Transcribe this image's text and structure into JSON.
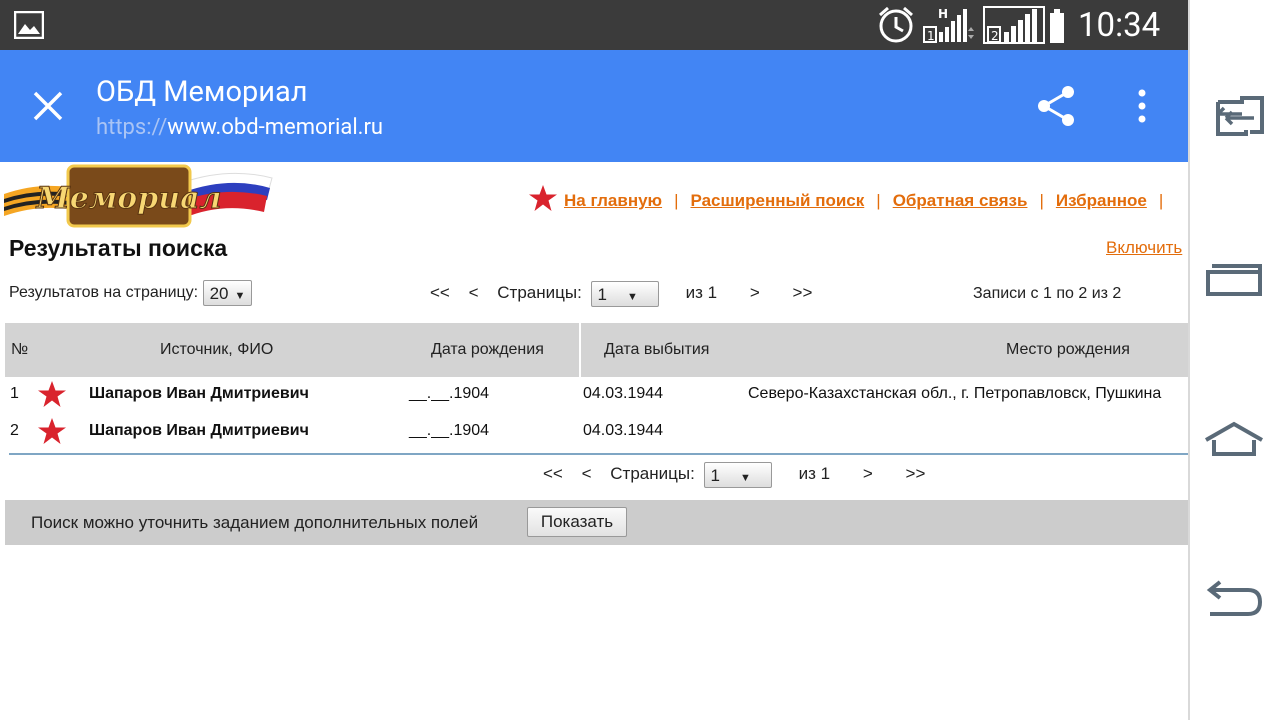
{
  "status": {
    "time": "10:34",
    "sim1": "1",
    "sim2": "2",
    "net": "H"
  },
  "appbar": {
    "title": "ОБД Мемориал",
    "url_scheme": "https://",
    "url_host": "www.obd-memorial.ru"
  },
  "web": {
    "logo_text": "Мемориал",
    "topnav": {
      "home": "На главную",
      "advanced": "Расширенный поиск",
      "feedback": "Обратная связь",
      "favorites": "Избранное",
      "sep": "|"
    },
    "heading": "Результаты поиска",
    "enable_link": "Включить",
    "perpage": {
      "label": "Результатов на страницу:",
      "value": "20"
    },
    "pager": {
      "first": "<<",
      "prev": "<",
      "pages_label": "Страницы:",
      "page": "1",
      "of": "из 1",
      "next": ">",
      "last": ">>"
    },
    "records": "Записи с 1 по 2 из 2",
    "table": {
      "columns": [
        "№",
        "Источник, ФИО",
        "Дата рождения",
        "Дата выбытия",
        "Место рождения"
      ],
      "rows": [
        {
          "num": "1",
          "name": "Шапаров Иван Дмитриевич",
          "birth": "__.__.1904",
          "leave": "04.03.1944",
          "place": "Северо-Казахстанская обл., г. Петропавловск, Пушкина"
        },
        {
          "num": "2",
          "name": "Шапаров Иван Дмитриевич",
          "birth": "__.__.1904",
          "leave": "04.03.1944",
          "place": ""
        }
      ]
    },
    "refine": {
      "text": "Поиск можно уточнить заданием дополнительных полей",
      "button": "Показать"
    }
  },
  "colors": {
    "appbar": "#4285f4",
    "statusbar": "#3b3b3b",
    "link": "#e36d0c",
    "star": "#d9232d"
  },
  "navbar_icons": [
    "recent-switch-icon",
    "dual-window-icon",
    "home-icon",
    "back-icon"
  ]
}
